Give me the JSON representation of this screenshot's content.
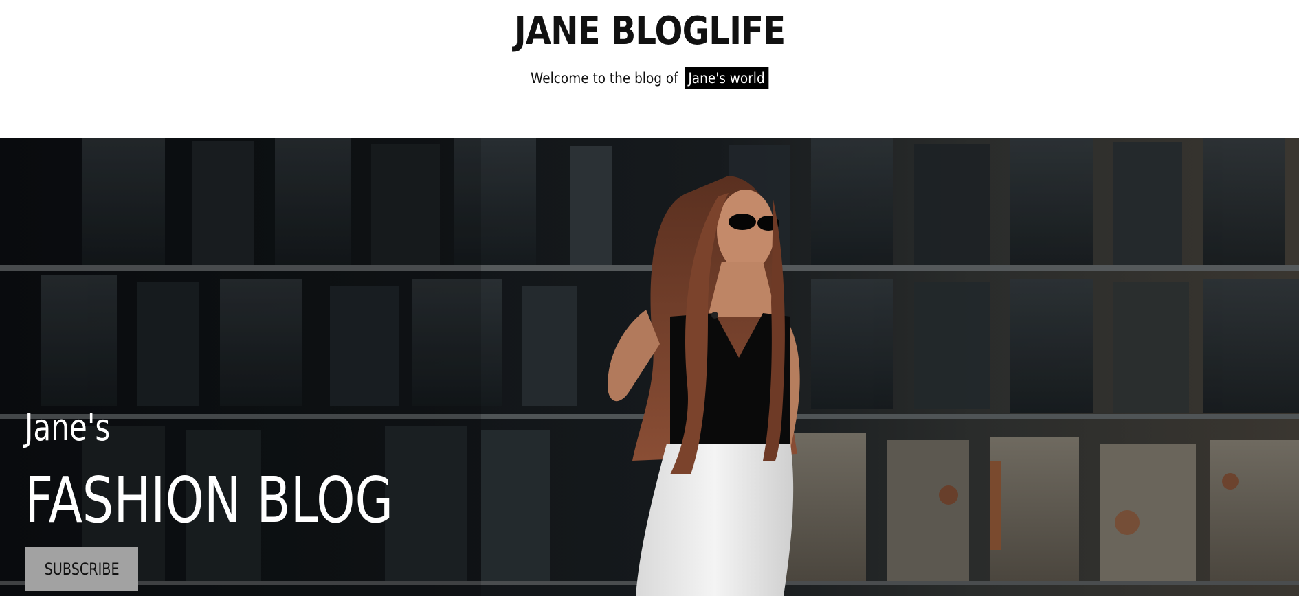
{
  "header": {
    "site_title": "JANE BLOGLIFE",
    "tagline_prefix": "Welcome to the blog of",
    "tagline_highlight": "Jane's world"
  },
  "hero": {
    "kicker": "Jane's",
    "title": "FASHION BLOG",
    "subscribe_label": "SUBSCRIBE",
    "image_alt": "fashion-model-photo"
  },
  "colors": {
    "page_background": "#ffffff",
    "text_dark": "#111111",
    "highlight_background": "#000000",
    "button_background": "#a2a2a2"
  }
}
